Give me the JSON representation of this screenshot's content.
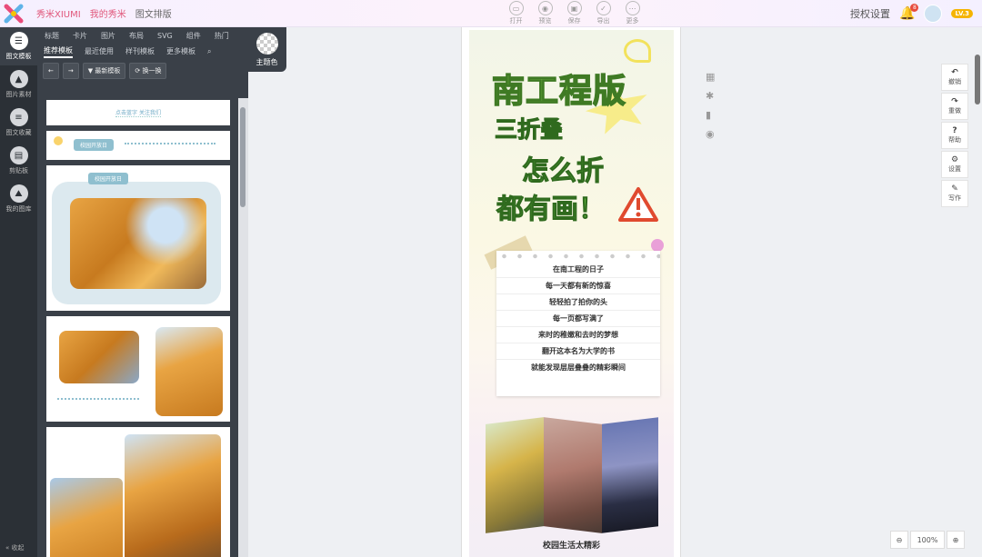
{
  "topbar": {
    "brand": "秀米XIUMI",
    "my": "我的秀米",
    "mode": "图文排版",
    "tools": [
      {
        "icon": "folder-icon",
        "label": "打开"
      },
      {
        "icon": "eye-icon",
        "label": "预览"
      },
      {
        "icon": "save-icon",
        "label": "保存"
      },
      {
        "icon": "check-icon",
        "label": "导出"
      },
      {
        "icon": "more-icon",
        "label": "更多"
      }
    ],
    "auth": "授权设置",
    "badge": "8",
    "level": "LV.3"
  },
  "leftbar": {
    "items": [
      "图文模板",
      "图片素材",
      "图文收藏",
      "剪贴板",
      "我的图库"
    ],
    "collapse": "收起"
  },
  "panel": {
    "categories": [
      "标题",
      "卡片",
      "图片",
      "布局",
      "SVG",
      "组件",
      "热门"
    ],
    "subtabs": [
      "推荐模板",
      "最近使用",
      "样刊模板",
      "更多模板"
    ],
    "btn_new": "最新模板",
    "btn_swap": "换一换",
    "card1_text": "点击蓝字 关注我们",
    "tag1": "校园开放日",
    "tag2": "校园开放日"
  },
  "theme": "主题色",
  "article": {
    "title1": "南工程版",
    "title2": "三折叠",
    "title3": "怎么折",
    "title4": "都有画！",
    "lines": [
      "在南工程的日子",
      "每一天都有新的惊喜",
      "轻轻拍了拍你的头",
      "每一页都写满了",
      "来时的稚嫩和去时的梦想",
      "翻开这本名为大学的书",
      "就能发现层层叠叠的精彩瞬间"
    ],
    "caption": "校园生活太精彩"
  },
  "rtools": [
    {
      "icon": "undo-icon",
      "label": "撤销"
    },
    {
      "icon": "redo-icon",
      "label": "重做"
    },
    {
      "icon": "help-icon",
      "label": "帮助"
    },
    {
      "icon": "gear-icon",
      "label": "设置"
    },
    {
      "icon": "pen-icon",
      "label": "写作"
    }
  ],
  "zoom": "100%"
}
